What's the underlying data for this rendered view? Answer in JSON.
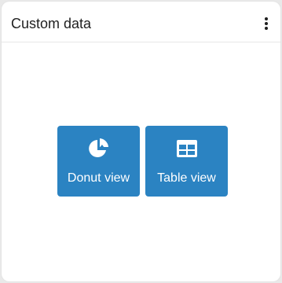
{
  "card": {
    "title": "Custom data",
    "menu_icon": "kebab-menu-icon"
  },
  "views": {
    "donut": {
      "label": "Donut view",
      "icon": "pie-chart-icon"
    },
    "table": {
      "label": "Table view",
      "icon": "table-icon"
    }
  },
  "colors": {
    "accent": "#2b83c2",
    "title": "#1f1f1f",
    "background": "#e9e9e9",
    "card": "#ffffff"
  }
}
